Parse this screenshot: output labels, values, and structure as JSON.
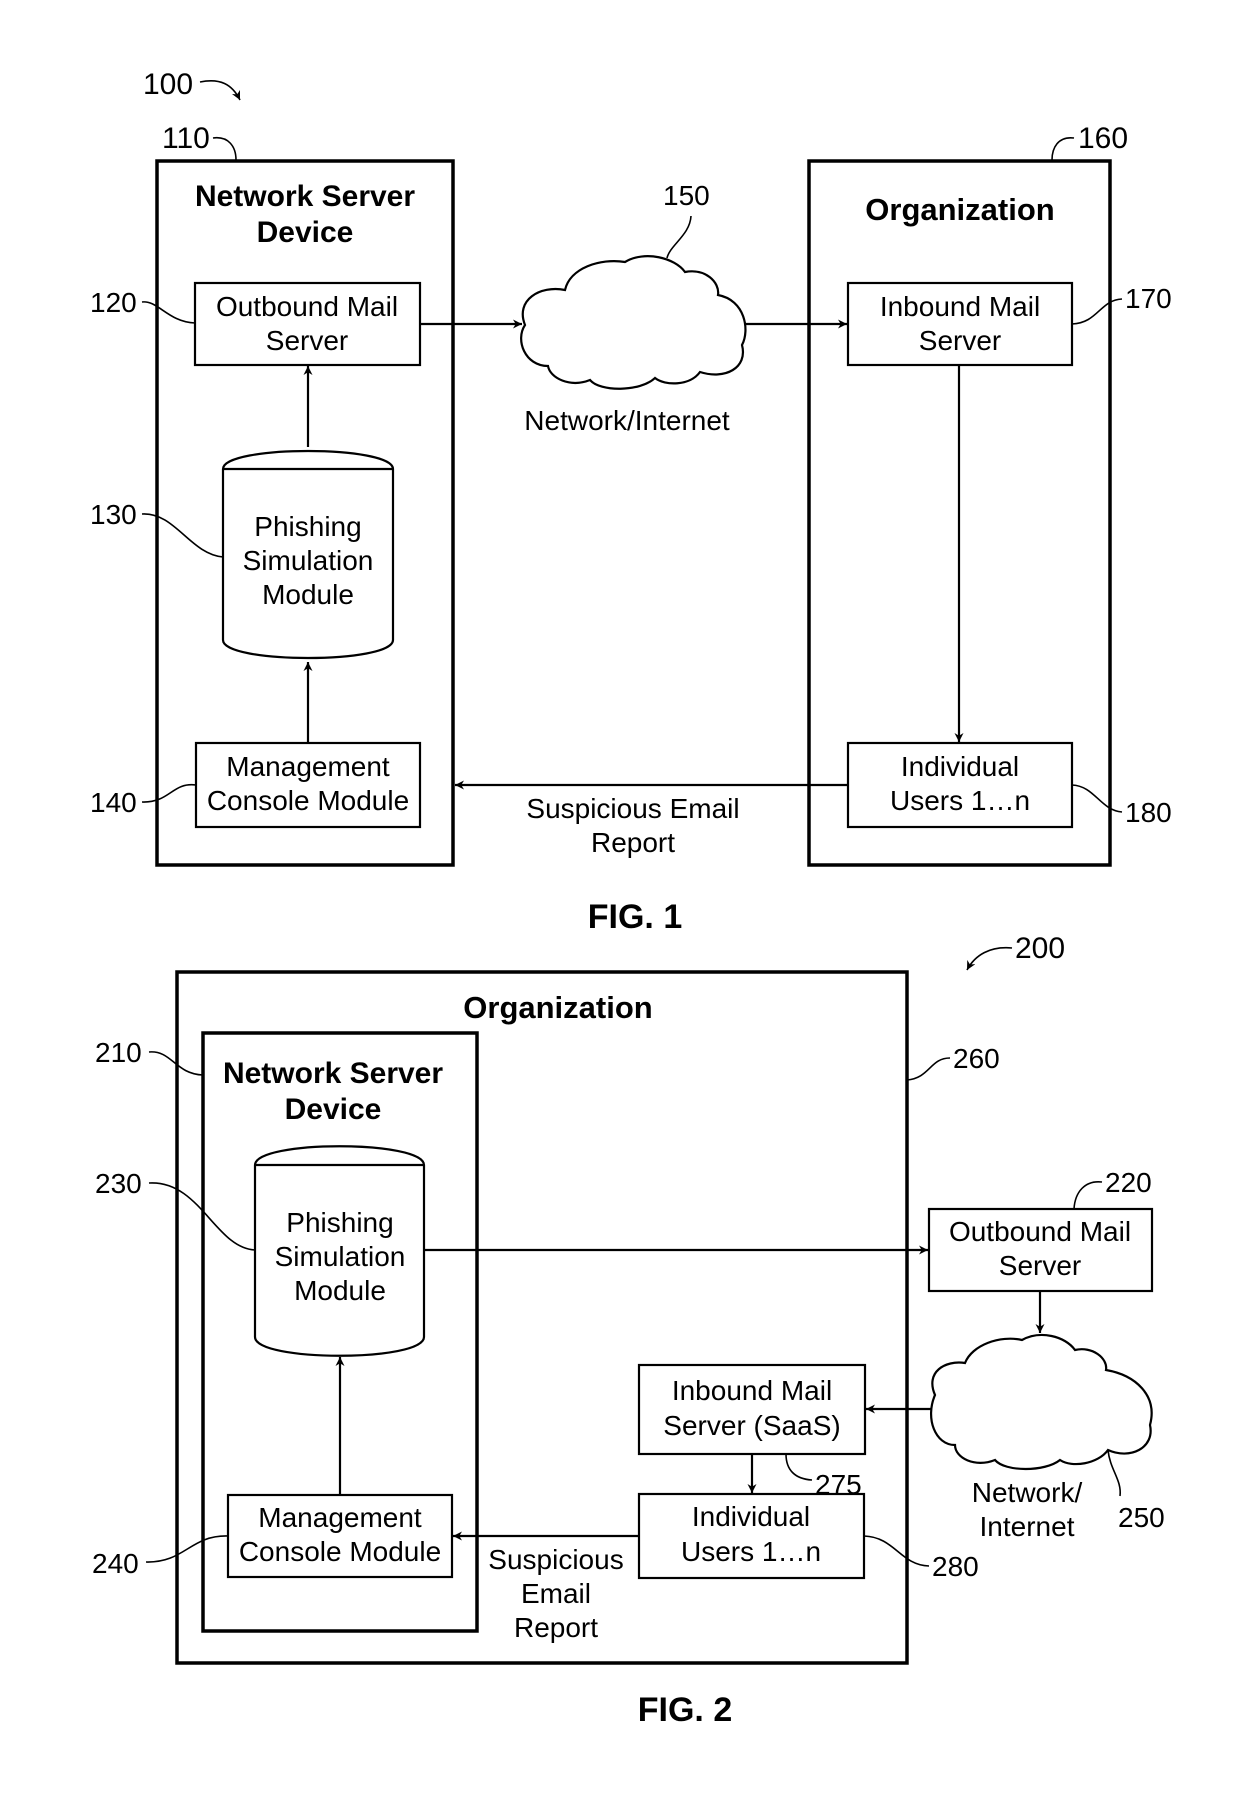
{
  "fig1": {
    "label": "FIG. 1",
    "ref": "100",
    "network_server_device": {
      "ref": "110",
      "title_line1": "Network Server",
      "title_line2": "Device"
    },
    "outbound_mail_server": {
      "ref": "120",
      "line1": "Outbound Mail",
      "line2": "Server"
    },
    "phishing_simulation_module": {
      "ref": "130",
      "line1": "Phishing",
      "line2": "Simulation",
      "line3": "Module"
    },
    "management_console_module": {
      "ref": "140",
      "line1": "Management",
      "line2": "Console Module"
    },
    "network": {
      "ref": "150",
      "label": "Network/Internet"
    },
    "organization": {
      "ref": "160",
      "title": "Organization"
    },
    "inbound_mail_server": {
      "ref": "170",
      "line1": "Inbound Mail",
      "line2": "Server"
    },
    "individual_users": {
      "ref": "180",
      "line1": "Individual",
      "line2": "Users 1…n"
    },
    "report_label_line1": "Suspicious Email",
    "report_label_line2": "Report"
  },
  "fig2": {
    "label": "FIG. 2",
    "ref": "200",
    "organization": {
      "ref": "260",
      "title": "Organization"
    },
    "network_server_device": {
      "ref": "210",
      "title_line1": "Network Server",
      "title_line2": "Device"
    },
    "phishing_simulation_module": {
      "ref": "230",
      "line1": "Phishing",
      "line2": "Simulation",
      "line3": "Module"
    },
    "management_console_module": {
      "ref": "240",
      "line1": "Management",
      "line2": "Console Module"
    },
    "outbound_mail_server": {
      "ref": "220",
      "line1": "Outbound Mail",
      "line2": "Server"
    },
    "network": {
      "ref": "250",
      "line1": "Network/",
      "line2": "Internet"
    },
    "inbound_mail_server": {
      "ref": "275",
      "line1": "Inbound Mail",
      "line2": "Server (SaaS)"
    },
    "individual_users": {
      "ref": "280",
      "line1": "Individual",
      "line2": "Users 1…n"
    },
    "report_label_line1": "Suspicious",
    "report_label_line2": "Email",
    "report_label_line3": "Report"
  }
}
